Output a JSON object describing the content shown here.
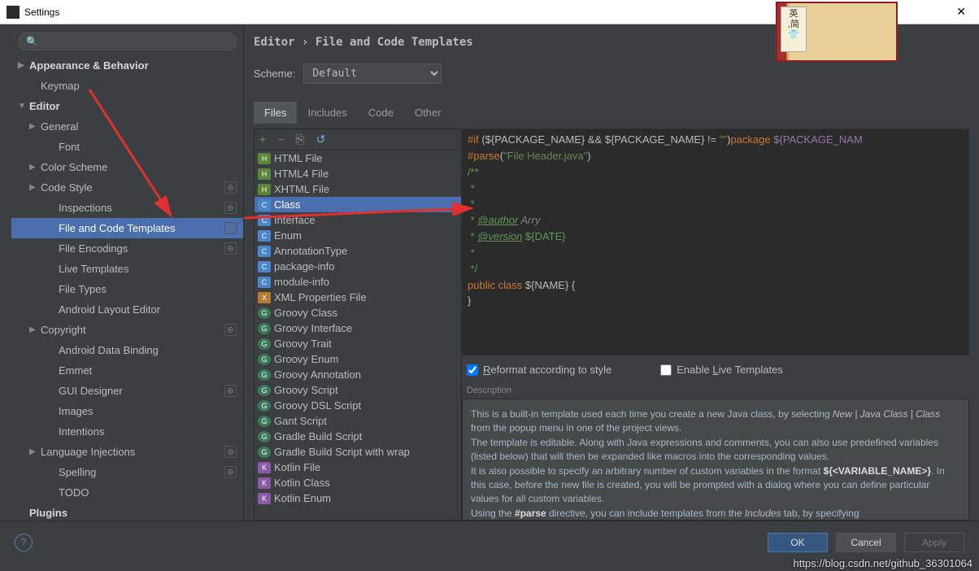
{
  "window": {
    "title": "Settings"
  },
  "search": {
    "placeholder": ""
  },
  "sidebar": {
    "items": [
      {
        "label": "Appearance & Behavior",
        "lvl": 0,
        "arrow": "▶",
        "bold": true
      },
      {
        "label": "Keymap",
        "lvl": 1
      },
      {
        "label": "Editor",
        "lvl": 0,
        "arrow": "▼",
        "bold": true
      },
      {
        "label": "General",
        "lvl": 1,
        "arrow": "▶"
      },
      {
        "label": "Font",
        "lvl": 2
      },
      {
        "label": "Color Scheme",
        "lvl": 1,
        "arrow": "▶"
      },
      {
        "label": "Code Style",
        "lvl": 1,
        "arrow": "▶",
        "boxed": "⊕"
      },
      {
        "label": "Inspections",
        "lvl": 2,
        "boxed": "⊕"
      },
      {
        "label": "File and Code Templates",
        "lvl": 2,
        "selected": true,
        "boxed": "⊕"
      },
      {
        "label": "File Encodings",
        "lvl": 2,
        "boxed": "⊕"
      },
      {
        "label": "Live Templates",
        "lvl": 2
      },
      {
        "label": "File Types",
        "lvl": 2
      },
      {
        "label": "Android Layout Editor",
        "lvl": 2
      },
      {
        "label": "Copyright",
        "lvl": 1,
        "arrow": "▶",
        "boxed": "⊕"
      },
      {
        "label": "Android Data Binding",
        "lvl": 2
      },
      {
        "label": "Emmet",
        "lvl": 2
      },
      {
        "label": "GUI Designer",
        "lvl": 2,
        "boxed": "⊕"
      },
      {
        "label": "Images",
        "lvl": 2
      },
      {
        "label": "Intentions",
        "lvl": 2
      },
      {
        "label": "Language Injections",
        "lvl": 1,
        "arrow": "▶",
        "boxed": "⊕"
      },
      {
        "label": "Spelling",
        "lvl": 2,
        "boxed": "⊕"
      },
      {
        "label": "TODO",
        "lvl": 2
      },
      {
        "label": "Plugins",
        "lvl": 0,
        "bold": true
      }
    ]
  },
  "breadcrumb": "Editor › File and Code Templates",
  "scheme": {
    "label": "Scheme:",
    "value": "Default"
  },
  "tabs": [
    "Files",
    "Includes",
    "Code",
    "Other"
  ],
  "activeTab": 0,
  "toolbar": {
    "add": "+",
    "remove": "−",
    "copy": "⎘",
    "reset": "↺"
  },
  "files": [
    {
      "label": "HTML File",
      "icon": "html"
    },
    {
      "label": "HTML4 File",
      "icon": "html"
    },
    {
      "label": "XHTML File",
      "icon": "html"
    },
    {
      "label": "Class",
      "icon": "class",
      "selected": true
    },
    {
      "label": "Interface",
      "icon": "class"
    },
    {
      "label": "Enum",
      "icon": "class"
    },
    {
      "label": "AnnotationType",
      "icon": "class"
    },
    {
      "label": "package-info",
      "icon": "java"
    },
    {
      "label": "module-info",
      "icon": "java"
    },
    {
      "label": "XML Properties File",
      "icon": "xml"
    },
    {
      "label": "Groovy Class",
      "icon": "groovy"
    },
    {
      "label": "Groovy Interface",
      "icon": "groovy"
    },
    {
      "label": "Groovy Trait",
      "icon": "groovy"
    },
    {
      "label": "Groovy Enum",
      "icon": "groovy"
    },
    {
      "label": "Groovy Annotation",
      "icon": "groovy"
    },
    {
      "label": "Groovy Script",
      "icon": "groovy"
    },
    {
      "label": "Groovy DSL Script",
      "icon": "groovy"
    },
    {
      "label": "Gant Script",
      "icon": "groovy"
    },
    {
      "label": "Gradle Build Script",
      "icon": "groovy"
    },
    {
      "label": "Gradle Build Script with wrap",
      "icon": "groovy"
    },
    {
      "label": "Kotlin File",
      "icon": "kotlin"
    },
    {
      "label": "Kotlin Class",
      "icon": "kotlin"
    },
    {
      "label": "Kotlin Enum",
      "icon": "kotlin"
    }
  ],
  "code": {
    "l1a": "#if",
    "l1b": " (${PACKAGE_NAME} && ${PACKAGE_NAME} != ",
    "l1c": "\"\"",
    "l1d": ")",
    "l1e": "package",
    "l1f": " ${PACKAGE_NAM",
    "l2a": "#parse",
    "l2b": "(",
    "l2c": "\"File Header.java\"",
    "l2d": ")",
    "l3": "/**",
    "l4": " *",
    "l5": " *",
    "l6a": " * ",
    "l6b": "@author",
    "l6c": " Arry",
    "l7a": " * ",
    "l7b": "@version",
    "l7c": " ${DATE}",
    "l8": " *",
    "l9": " */",
    "l10a": "public class ",
    "l10b": "${NAME} {",
    "l11": "}"
  },
  "options": {
    "reformat_checked": true,
    "reformat_label_pre": "R",
    "reformat_label_rest": "eformat according to style",
    "live_checked": false,
    "live_label_pre": "Enable ",
    "live_label_u": "L",
    "live_label_rest": "ive Templates"
  },
  "desc_label": "Description",
  "description": {
    "p1a": "This is a built-in template used each time you create a new Java class, by selecting ",
    "p1b": "New | Java Class | Class",
    "p1c": " from the popup menu in one of the project views.",
    "p2": "The template is editable. Along with Java expressions and comments, you can also use predefined variables (listed below) that will then be expanded like macros into the corresponding values.",
    "p3a": "It is also possible to specify an arbitrary number of custom variables in the format ",
    "p3b": "${<VARIABLE_NAME>}",
    "p3c": ". In this case, before the new file is created, you will be prompted with a dialog where you can define particular values for all custom variables.",
    "p4a": "Using the ",
    "p4b": "#parse",
    "p4c": " directive, you can include templates from the ",
    "p4d": "Includes",
    "p4e": " tab, by specifying"
  },
  "buttons": {
    "ok": "OK",
    "cancel": "Cancel",
    "apply": "Apply"
  },
  "watermark": "https://blog.csdn.net/github_36301064"
}
